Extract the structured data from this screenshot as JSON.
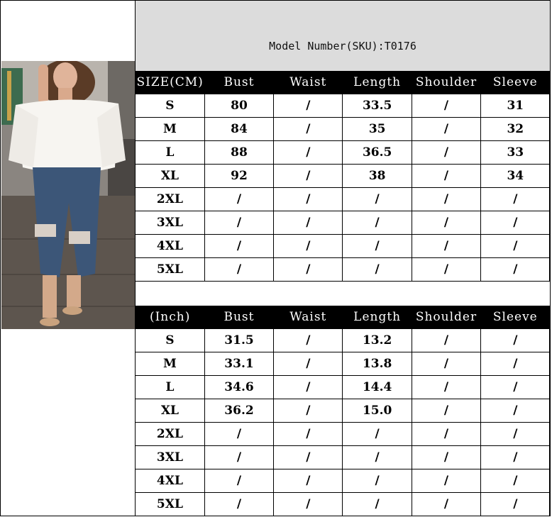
{
  "model_number": "Model Number(SKU):T0176",
  "cm_table": {
    "headers": [
      "SIZE(CM)",
      "Bust",
      "Waist",
      "Length",
      "Shoulder",
      "Sleeve"
    ],
    "rows": [
      [
        "S",
        "80",
        "/",
        "33.5",
        "/",
        "31"
      ],
      [
        "M",
        "84",
        "/",
        "35",
        "/",
        "32"
      ],
      [
        "L",
        "88",
        "/",
        "36.5",
        "/",
        "33"
      ],
      [
        "XL",
        "92",
        "/",
        "38",
        "/",
        "34"
      ],
      [
        "2XL",
        "/",
        "/",
        "/",
        "/",
        "/"
      ],
      [
        "3XL",
        "/",
        "/",
        "/",
        "/",
        "/"
      ],
      [
        "4XL",
        "/",
        "/",
        "/",
        "/",
        "/"
      ],
      [
        "5XL",
        "/",
        "/",
        "/",
        "/",
        "/"
      ]
    ]
  },
  "inch_table": {
    "headers": [
      "(Inch)",
      "Bust",
      "Waist",
      "Length",
      "Shoulder",
      "Sleeve"
    ],
    "rows": [
      [
        "S",
        "31.5",
        "/",
        "13.2",
        "/",
        "/"
      ],
      [
        "M",
        "33.1",
        "/",
        "13.8",
        "/",
        "/"
      ],
      [
        "L",
        "34.6",
        "/",
        "14.4",
        "/",
        "/"
      ],
      [
        "XL",
        "36.2",
        "/",
        "15.0",
        "/",
        "/"
      ],
      [
        "2XL",
        "/",
        "/",
        "/",
        "/",
        "/"
      ],
      [
        "3XL",
        "/",
        "/",
        "/",
        "/",
        "/"
      ],
      [
        "4XL",
        "/",
        "/",
        "/",
        "/",
        "/"
      ],
      [
        "5XL",
        "/",
        "/",
        "/",
        "/",
        "/"
      ]
    ]
  }
}
